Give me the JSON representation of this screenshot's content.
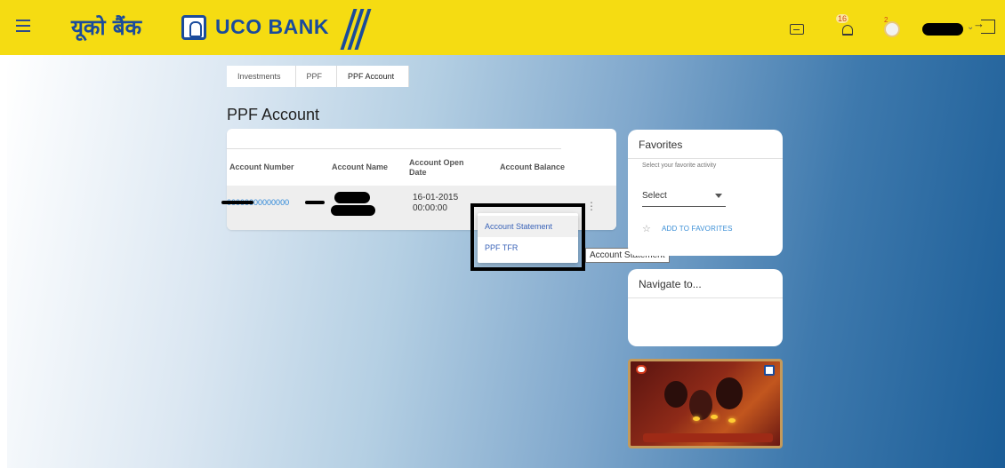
{
  "header": {
    "menu_icon": "hamburger-icon",
    "brand_hindi": "यूको बैंक",
    "brand_english": "UCO BANK",
    "brand_color": "#1a4b9c",
    "bar_color": "#f5dc12",
    "notification_count": "16",
    "avatar_badge": "2",
    "icons": [
      "mail-icon",
      "bell-icon",
      "avatar",
      "chevron-down-icon",
      "logout-icon"
    ]
  },
  "breadcrumb": [
    "Investments",
    "PPF",
    "PPF Account"
  ],
  "page": {
    "title": "PPF Account"
  },
  "accounts_table": {
    "headers": [
      "Account Number",
      "Account Name",
      "Account Open Date",
      "Account Balance"
    ],
    "rows": [
      {
        "account_number": "00000000000000",
        "account_name": "",
        "open_date_line1": "16-01-2015",
        "open_date_line2": "00:00:00",
        "balance": ""
      }
    ]
  },
  "row_menu": {
    "items": [
      "Account Statement",
      "PPF TFR"
    ],
    "tooltip": "Account Statement"
  },
  "favorites": {
    "title": "Favorites",
    "subtitle": "Select your favorite activity",
    "select_value": "Select",
    "add_label": "ADD TO FAVORITES"
  },
  "navigate": {
    "title": "Navigate to..."
  },
  "colors": {
    "link": "#2b86d8",
    "gradient_end": "#1b5d97"
  }
}
